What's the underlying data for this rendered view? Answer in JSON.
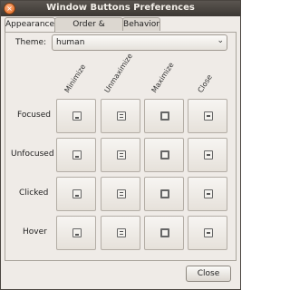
{
  "window": {
    "title": "Window Buttons Preferences"
  },
  "tabs": [
    {
      "label": "Appearance",
      "active": true
    },
    {
      "label": "Order & Visibility",
      "active": false
    },
    {
      "label": "Behavior",
      "active": false
    }
  ],
  "theme": {
    "label": "Theme:",
    "value": "human"
  },
  "columns": [
    "Minimize",
    "Unmaximize",
    "Maximize",
    "Close"
  ],
  "rows": [
    "Focused",
    "Unfocused",
    "Clicked",
    "Hover"
  ],
  "icons": [
    [
      "minimize-icon",
      "unmaximize-icon",
      "maximize-icon",
      "close-icon"
    ],
    [
      "minimize-icon",
      "unmaximize-icon",
      "maximize-icon",
      "close-icon"
    ],
    [
      "minimize-icon",
      "unmaximize-icon",
      "maximize-icon",
      "close-icon"
    ],
    [
      "minimize-icon",
      "unmaximize-icon",
      "maximize-icon",
      "close-icon"
    ]
  ],
  "footer": {
    "close_label": "Close"
  },
  "colors": {
    "titlebar": "#3c3833",
    "window_bg": "#efebe7",
    "accent": "#e06418"
  }
}
